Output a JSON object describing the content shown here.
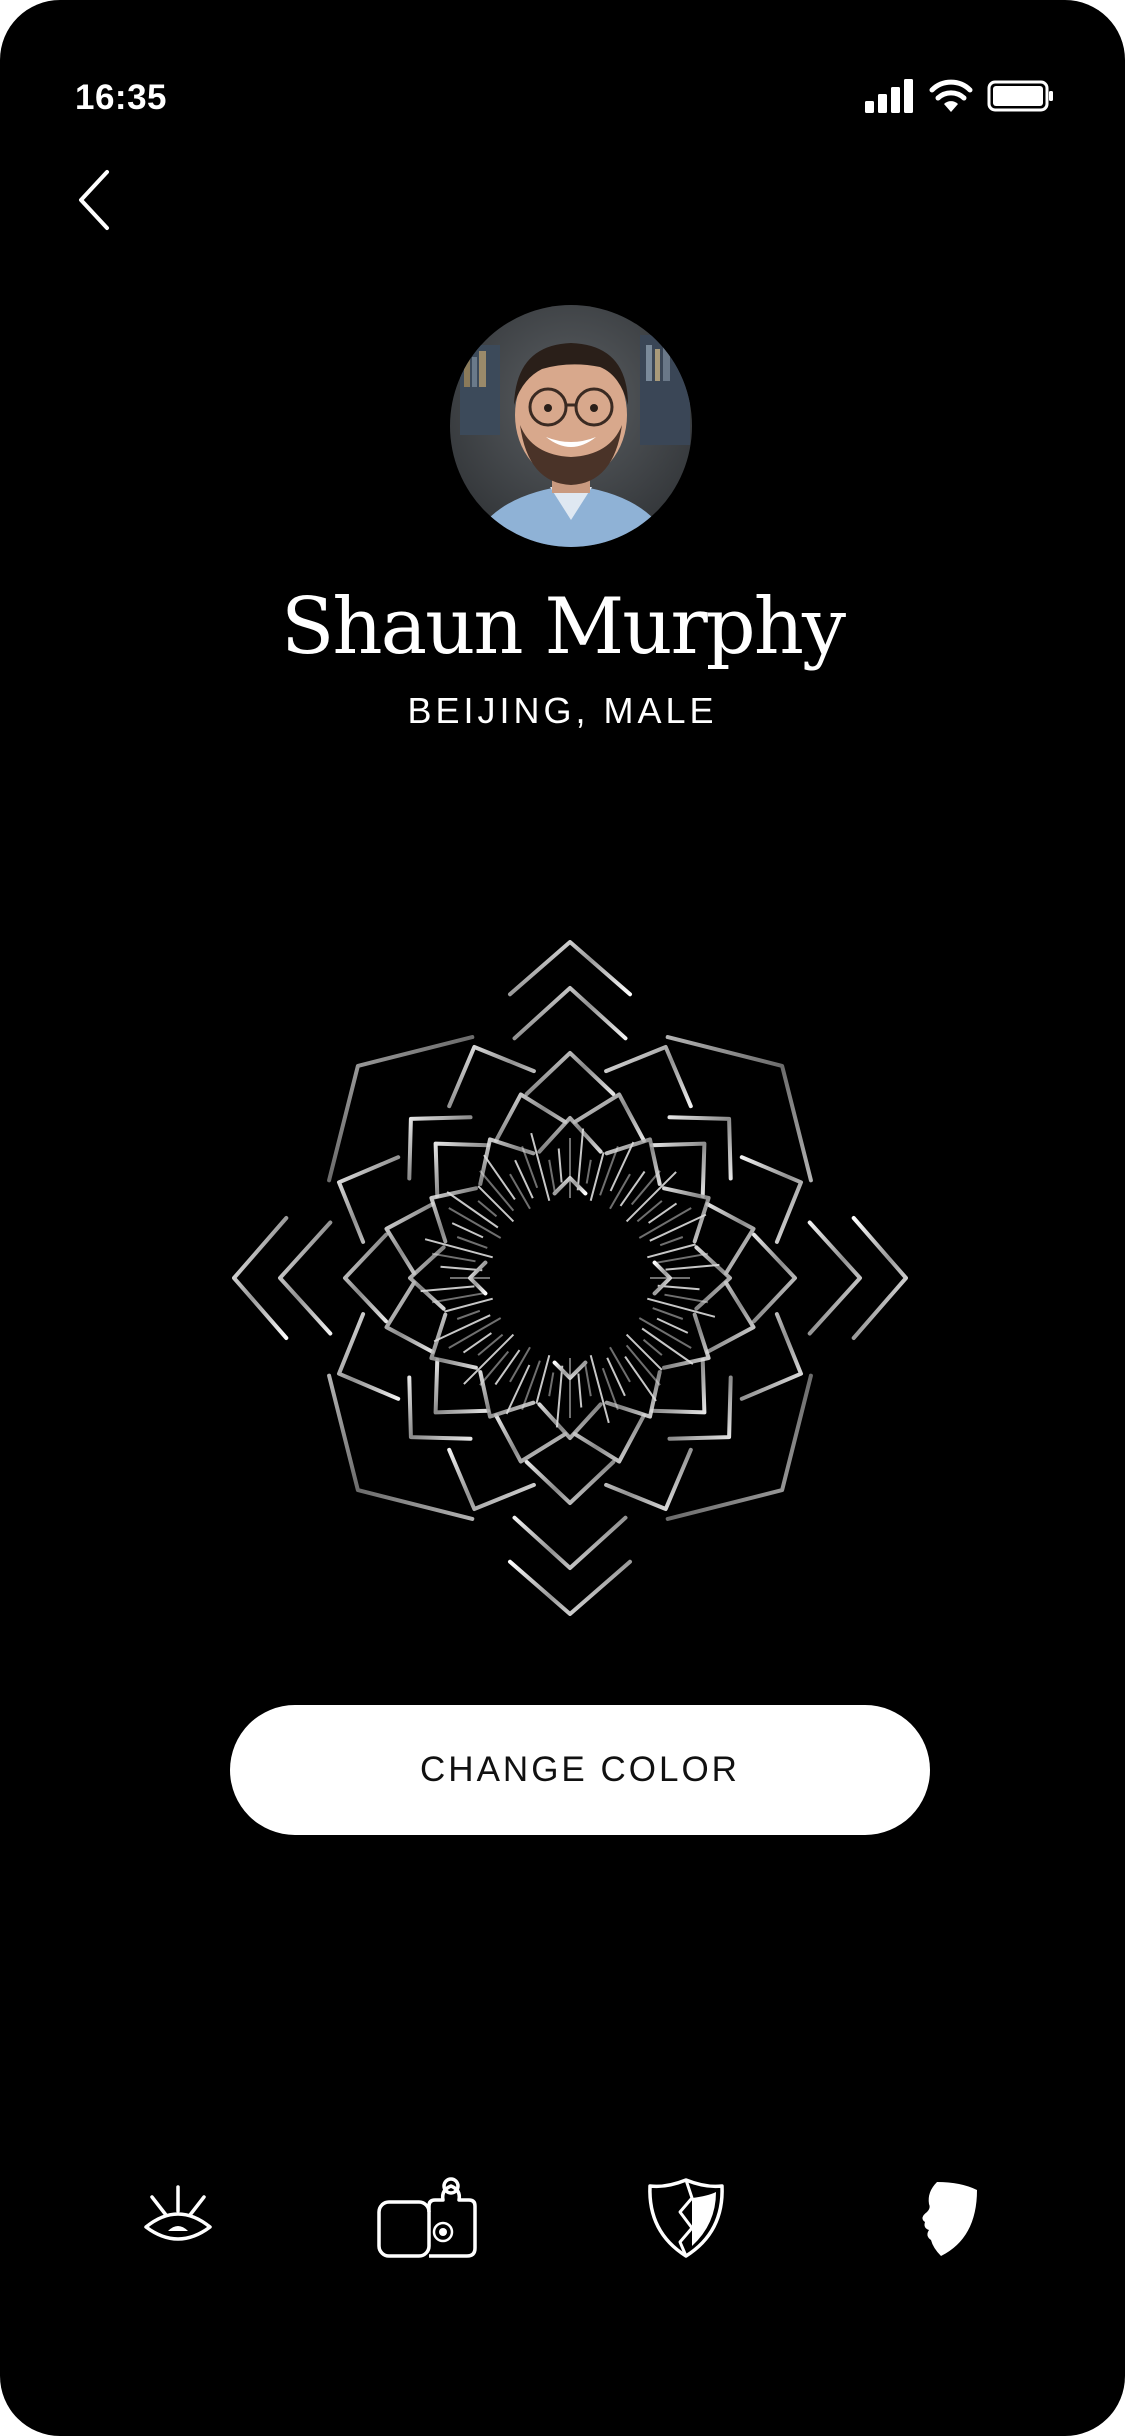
{
  "status_bar": {
    "time": "16:35",
    "icons": [
      "signal-icon",
      "wifi-icon",
      "battery-icon"
    ]
  },
  "navigation": {
    "back_icon": "chevron-left-icon"
  },
  "profile": {
    "name": "Shaun Murphy",
    "subtitle": "BEIJING, MALE",
    "avatar": "avatar-photo"
  },
  "pattern": {
    "icon": "mandala-pattern"
  },
  "actions": {
    "change_color_label": "CHANGE COLOR"
  },
  "tab_bar": {
    "tabs": [
      {
        "icon": "eye-rays-icon",
        "active": false
      },
      {
        "icon": "puzzle-cards-icon",
        "active": false
      },
      {
        "icon": "shield-split-icon",
        "active": false
      },
      {
        "icon": "face-mask-icon",
        "active": true
      }
    ]
  },
  "colors": {
    "background": "#000000",
    "foreground": "#ffffff",
    "button_background": "#ffffff",
    "button_text": "#111111"
  }
}
